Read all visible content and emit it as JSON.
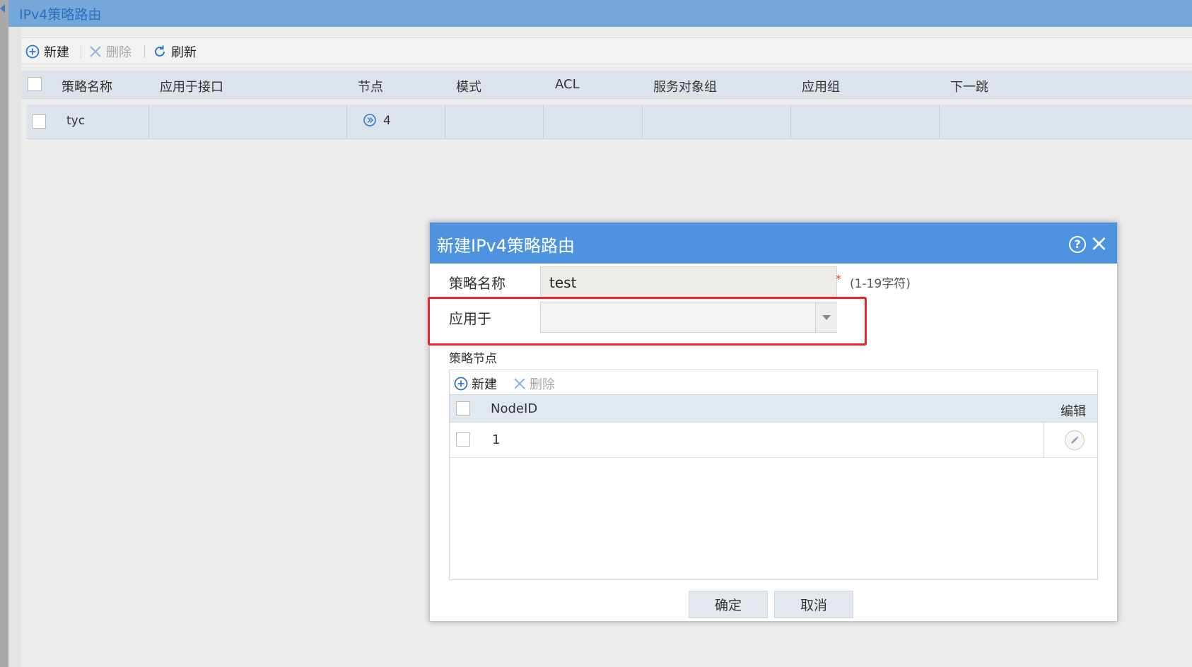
{
  "window": {
    "title": "IPv4策略路由"
  },
  "toolbar": {
    "new_label": "新建",
    "delete_label": "删除",
    "refresh_label": "刷新"
  },
  "grid": {
    "columns": [
      "策略名称",
      "应用于接口",
      "节点",
      "模式",
      "ACL",
      "服务对象组",
      "应用组",
      "下一跳"
    ],
    "rows": [
      {
        "name": "tyc",
        "interface": "",
        "nodes": "4",
        "mode": "",
        "acl": "",
        "service_group": "",
        "app_group": "",
        "next_hop": ""
      }
    ]
  },
  "dialog": {
    "title": "新建IPv4策略路由",
    "name_label": "策略名称",
    "name_value": "test",
    "required_mark": "*",
    "name_hint": "(1-19字符)",
    "apply_label": "应用于",
    "apply_value": "",
    "nodes_section_label": "策略节点",
    "nodes_toolbar": {
      "new_label": "新建",
      "delete_label": "删除"
    },
    "nodes_table": {
      "columns": [
        "NodeID",
        "编辑"
      ],
      "rows": [
        {
          "node_id": "1"
        }
      ]
    },
    "ok_label": "确定",
    "cancel_label": "取消"
  },
  "colors": {
    "dialog_header": "#4d93e0",
    "highlight_border": "#e7262b",
    "titlebar": "#75a8d9"
  }
}
